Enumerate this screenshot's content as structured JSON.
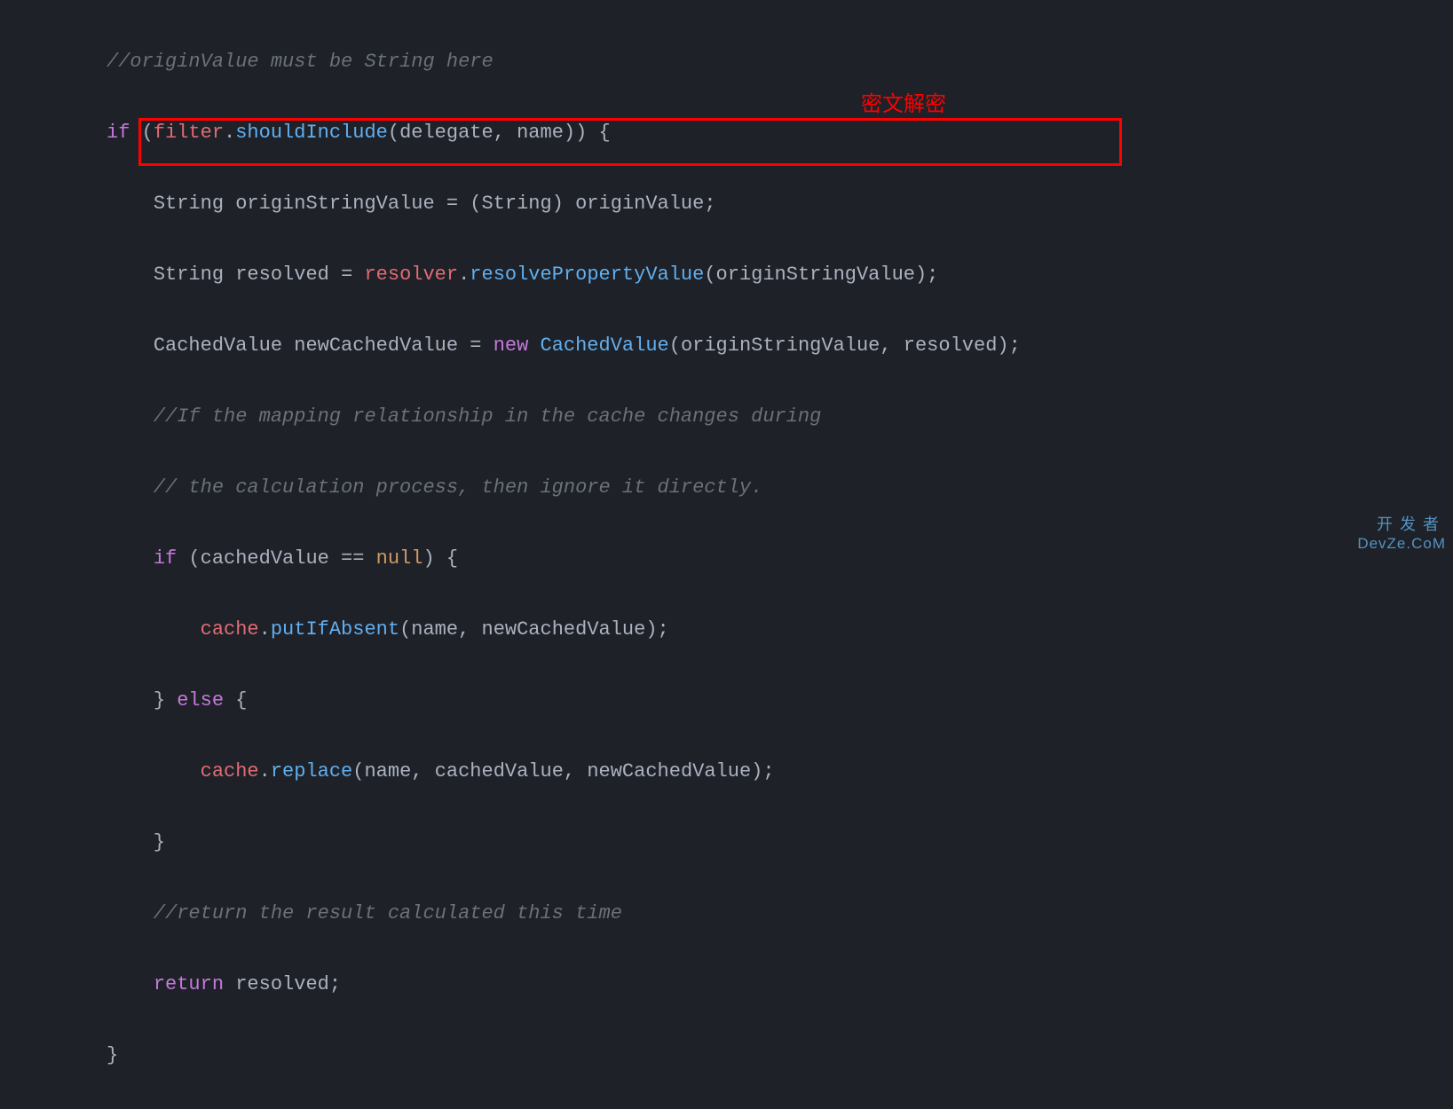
{
  "code": {
    "line1_comment": "//originValue must be String here",
    "line2": {
      "kw_if": "if",
      "paren_open": " (",
      "var_filter": "filter",
      "dot1": ".",
      "method_shouldInclude": "shouldInclude",
      "call_open": "(",
      "var_delegate": "delegate",
      "comma": ", ",
      "var_name": "name",
      "call_close": ")) {",
      "close_paren": ""
    },
    "line3": {
      "indent": "    ",
      "type_String": "String",
      "var_originStringValue": " originStringValue ",
      "equals": "= ",
      "cast": "(String) ",
      "var_originValue": "originValue",
      "semi": ";"
    },
    "line4": {
      "indent": "    ",
      "type_String": "String",
      "var_resolved": " resolved ",
      "equals": "= ",
      "var_resolver": "resolver",
      "dot": ".",
      "method": "resolvePropertyValue",
      "paren_open": "(",
      "arg": "originStringValue",
      "paren_close": ");"
    },
    "line5": {
      "indent": "    ",
      "type": "CachedValue",
      "var": " newCachedValue ",
      "equals": "= ",
      "kw_new": "new",
      "sp": " ",
      "ctor": "CachedValue",
      "paren_open": "(",
      "arg1": "originStringValue",
      "comma": ", ",
      "arg2": "resolved",
      "paren_close": ");"
    },
    "line6_comment": "    //If the mapping relationship in the cache changes during",
    "line7_comment": "    // the calculation process, then ignore it directly.",
    "line8": {
      "indent": "    ",
      "kw_if": "if",
      "paren_open": " (",
      "var": "cachedValue",
      "op": " == ",
      "null": "null",
      "paren_close": ") {"
    },
    "line9": {
      "indent": "        ",
      "var_cache": "cache",
      "dot": ".",
      "method": "putIfAbsent",
      "paren_open": "(",
      "arg1": "name",
      "comma": ", ",
      "arg2": "newCachedValue",
      "paren_close": ");"
    },
    "line10": {
      "indent": "    ",
      "brace_close": "} ",
      "kw_else": "else",
      "brace_open": " {"
    },
    "line11": {
      "indent": "        ",
      "var_cache": "cache",
      "dot": ".",
      "method": "replace",
      "paren_open": "(",
      "arg1": "name",
      "comma1": ", ",
      "arg2": "cachedValue",
      "comma2": ", ",
      "arg3": "newCachedValue",
      "paren_close": ");"
    },
    "line12": "    }",
    "line13_comment": "    //return the result calculated this time",
    "line14": {
      "indent": "    ",
      "kw_return": "return",
      "sp": " ",
      "var": "resolved",
      "semi": ";"
    },
    "line15": "}"
  },
  "annotation": "密文解密",
  "watermark": {
    "cn": "开发者",
    "en": "DevZe.CoM"
  }
}
